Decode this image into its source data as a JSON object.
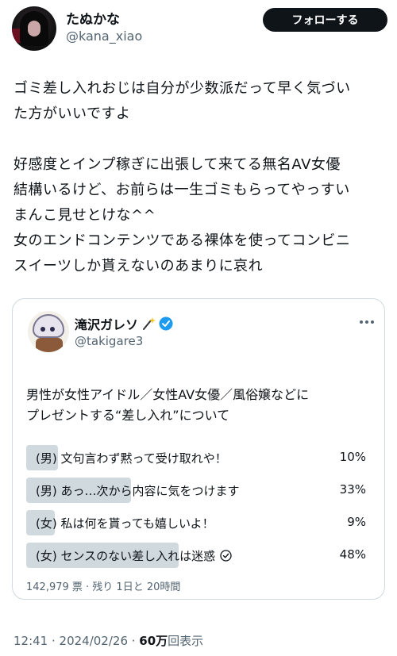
{
  "author": {
    "name": "たぬかな",
    "handle": "@kana_xiao",
    "follow_label": "フォローする"
  },
  "tweet": {
    "paragraph1": [
      "ゴミ差し入れおじは自分が少数派だって早く気づい",
      "た方がいいですよ"
    ],
    "paragraph2": [
      "好感度とインプ稼ぎに出張して来てる無名AV女優",
      "結構いるけど、お前らは一生ゴミもらってやっすい",
      "まんこ見せとけな^^",
      "女のエンドコンテンツである裸体を使ってコンビニ",
      "スイーツしか貰えないのあまりに哀れ"
    ]
  },
  "quote": {
    "name": "滝沢ガレソ",
    "handle": "@takigare3",
    "text": [
      "男性が女性アイドル／女性AV女優／風俗嬢などに",
      "プレゼントする“差し入れ”について"
    ],
    "poll": {
      "options": [
        {
          "label": "(男) 文句言わず黙って受け取れや！",
          "percent": "10%",
          "value": 10,
          "winner": false
        },
        {
          "label": "(男) あっ…次から内容に気をつけます",
          "percent": "33%",
          "value": 33,
          "winner": false
        },
        {
          "label": "(女) 私は何を貰っても嬉しいよ！",
          "percent": "9%",
          "value": 9,
          "winner": false
        },
        {
          "label": "(女) センスのない差し入れは迷惑",
          "percent": "48%",
          "value": 48,
          "winner": true
        }
      ],
      "meta": "142,979 票 · 残り 1日と 20時間"
    }
  },
  "footer": {
    "time": "12:41 · 2024/02/26 · ",
    "views_count": "60万",
    "views_label": "回表示"
  },
  "colors": {
    "accent": "#1d9bf0",
    "poll_fill": "#cfd9de",
    "secondary_text": "#536471"
  }
}
